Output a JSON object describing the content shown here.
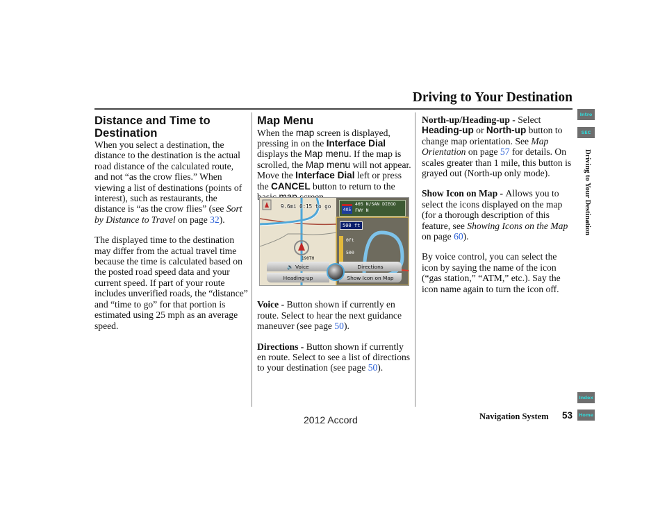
{
  "header": {
    "title": "Driving to Your Destination"
  },
  "side_nav": {
    "tabs": [
      {
        "label": "Intro"
      },
      {
        "label": "SEC"
      },
      {
        "label": "Index"
      },
      {
        "label": "Home"
      }
    ],
    "section_title": "Driving to Your Destination"
  },
  "column1": {
    "heading": "Distance and Time to Destination",
    "p1": {
      "text": "When you select a destination, the distance to the destination is the actual road distance of the calculated route, and not “as the crow flies.” When viewing a list of destinations (points of interest), such as restaurants, the distance is “as the crow flies” (see ",
      "ref_italic": "Sort by Distance to Travel",
      "on_page": " on page ",
      "page_link": "32",
      "end": ")."
    },
    "p2": "The displayed time to the destination may differ from the actual travel time because the time is calculated based on the posted road speed data and your current speed. If part of your route includes unverified roads, the “distance” and “time to go” for that portion is estimated using 25 mph as an average speed."
  },
  "column2": {
    "heading": "Map Menu",
    "intro": {
      "t1": "When the ",
      "s1": "map",
      "t2": " screen is displayed, pressing in on the ",
      "s2": "Interface Dial",
      "t3": " displays the ",
      "s3": "Map menu",
      "t4": ". If the map is scrolled, the ",
      "s4": "Map menu",
      "t5": " will not appear. Move the ",
      "s5": "Interface Dial",
      "t6": " left or press the ",
      "s6": "CANCEL",
      "t7": " button to return to the basic ",
      "s7": "map",
      "t8": " screen."
    },
    "voice": {
      "term": "Voice - ",
      "text": "Button shown if currently en route. Select to hear the next guidance maneuver (see page ",
      "page_link": "50",
      "end": ")."
    },
    "directions": {
      "term": "Directions - ",
      "text": "Button shown if currently en route. Select to see a list of directions to your destination (see page ",
      "page_link": "50",
      "end": ")."
    }
  },
  "column3": {
    "northup": {
      "term": "North-up/Heading-up - ",
      "t1": "Select ",
      "s1": "Heading-up",
      "t2": " or ",
      "s2": "North-up",
      "t3": " button to change map orientation. See ",
      "ref_italic": "Map Orientation",
      "t4": " on page ",
      "page_link": "57",
      "t5": " for details. On scales greater than 1 mile, this button is grayed out (North-up only mode)."
    },
    "showicon": {
      "term": "Show Icon on Map - ",
      "t1": "Allows you to select the icons displayed on the map (for a thorough description of this feature, see ",
      "ref_italic": "Showing Icons on the Map",
      "t2": " on page ",
      "page_link": "60",
      "t3": ")."
    },
    "voice_control": "By voice control, you can select the icon by saying the name of the icon (“gas station,” “ATM,” etc.). Say the icon name again to turn the icon off."
  },
  "map_screen": {
    "distance_info": "9.6mi 0:15 to go",
    "freeway_shield": "405",
    "street_sign": "405 N/SAN DIEGO FWY N",
    "scale": "500 ft",
    "gauge_top": "0ft",
    "gauge_bottom": "500",
    "street_name": "190TH",
    "menu": {
      "voice": "🔉 Voice",
      "directions": "Directions",
      "heading_up": "Heading-up",
      "show_icon": "Show Icon on Map"
    }
  },
  "footer": {
    "nav_label": "Navigation System",
    "page_number": "53",
    "model": "2012 Accord"
  }
}
